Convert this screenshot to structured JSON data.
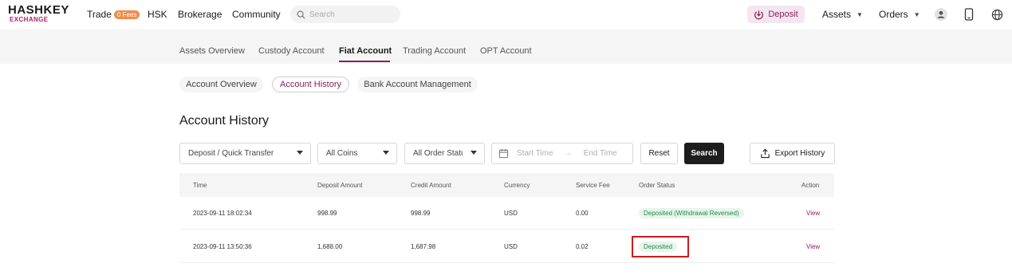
{
  "brand": {
    "line1": "HASHKEY",
    "line2": "EXCHANGE"
  },
  "nav": {
    "trade": "Trade",
    "trade_badge": "0 Fees",
    "hsk": "HSK",
    "brokerage": "Brokerage",
    "community": "Community",
    "search_placeholder": "Search",
    "deposit": "Deposit",
    "assets": "Assets",
    "orders": "Orders"
  },
  "subtabs": [
    {
      "label": "Assets Overview"
    },
    {
      "label": "Custody Account"
    },
    {
      "label": "Fiat Account"
    },
    {
      "label": "Trading Account"
    },
    {
      "label": "OPT Account"
    }
  ],
  "pills": [
    {
      "label": "Account Overview"
    },
    {
      "label": "Account History"
    },
    {
      "label": "Bank Account Management"
    }
  ],
  "page_title": "Account History",
  "filters": {
    "type": "Deposit / Quick Transfer",
    "coins": "All Coins",
    "status": "All Order Status",
    "start_placeholder": "Start Time",
    "end_placeholder": "End Time",
    "reset": "Reset",
    "search": "Search",
    "export": "Export History"
  },
  "table": {
    "headers": [
      "Time",
      "Deposit Amount",
      "Credit Amount",
      "Currency",
      "Service Fee",
      "Order Status",
      "Action"
    ],
    "rows": [
      {
        "time": "2023-09-11 18:02:34",
        "deposit": "998.99",
        "credit": "998.99",
        "currency": "USD",
        "fee": "0.00",
        "status": "Deposited (Withdrawal Reversed)",
        "action": "View"
      },
      {
        "time": "2023-09-11 13:50:36",
        "deposit": "1,688.00",
        "credit": "1,687.98",
        "currency": "USD",
        "fee": "0.02",
        "status": "Deposited",
        "action": "View"
      }
    ]
  },
  "colors": {
    "accent": "#8a1f5c",
    "status_green": "#23884a",
    "highlight": "#d11a1a"
  }
}
